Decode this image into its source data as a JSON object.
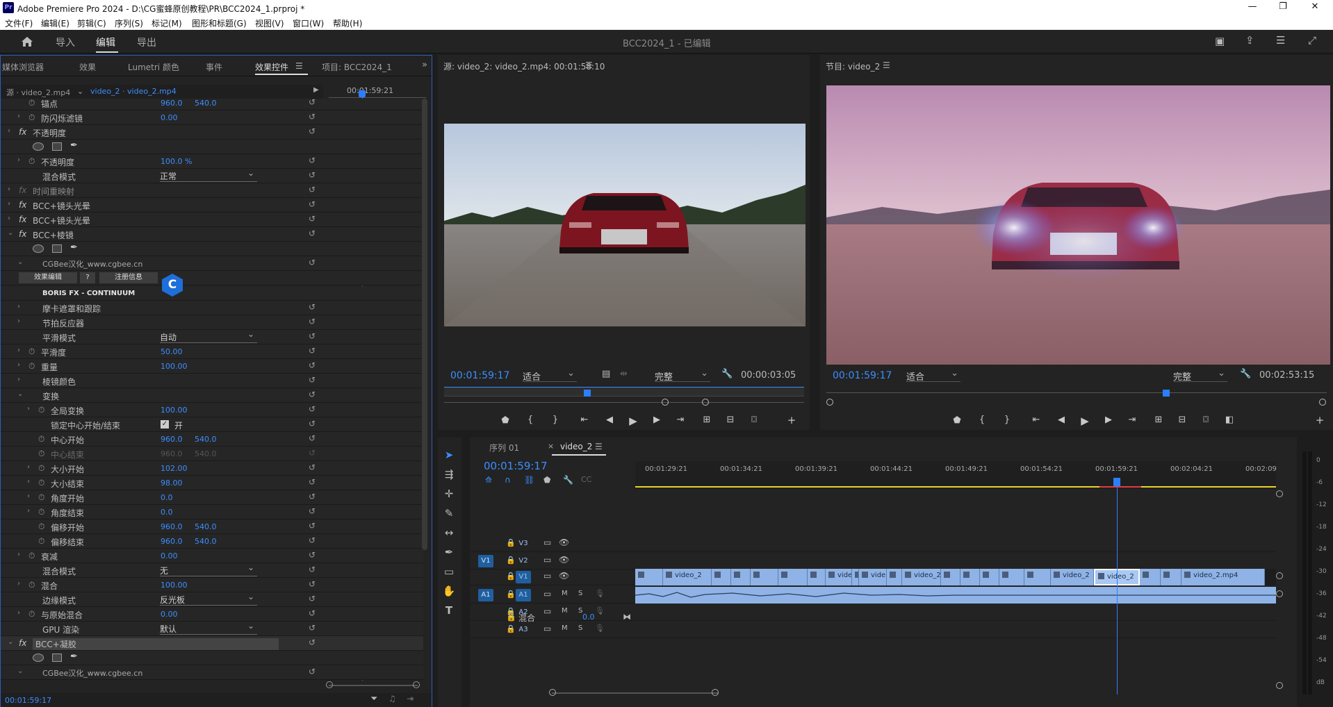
{
  "app": {
    "icon": "Pr",
    "title": "Adobe Premiere Pro 2024 - D:\\CG蜜蜂原创教程\\PR\\BCC2024_1.prproj *",
    "window_controls": [
      "—",
      "❐",
      "✕"
    ]
  },
  "menu": [
    "文件(F)",
    "编辑(E)",
    "剪辑(C)",
    "序列(S)",
    "标记(M)",
    "图形和标题(G)",
    "视图(V)",
    "窗口(W)",
    "帮助(H)"
  ],
  "workspace": {
    "tabs": [
      "导入",
      "编辑",
      "导出"
    ],
    "active": "编辑",
    "project_title": "BCC2024_1 - 已编辑"
  },
  "effects_panel": {
    "tabs": [
      "媒体浏览器",
      "效果",
      "Lumetri 颜色",
      "事件",
      "效果控件",
      "项目: BCC2024_1"
    ],
    "active_tab": "效果控件",
    "source_label": "源 · video_2.mp4",
    "clip_label": "video_2 · video_2.mp4",
    "mini_timecode": "00:01:59:21",
    "bottom_timecode": "00:01:59:17",
    "rows": [
      {
        "type": "prop",
        "indent": 2,
        "toggle": false,
        "stopwatch": true,
        "label": "锚点",
        "v1": "960.0",
        "v2": "540.0"
      },
      {
        "type": "prop",
        "indent": 2,
        "toggle": true,
        "stopwatch": true,
        "label": "防闪烁滤镜",
        "v1": "0.00"
      },
      {
        "type": "fx",
        "label": "不透明度"
      },
      {
        "type": "shapes"
      },
      {
        "type": "prop",
        "indent": 2,
        "toggle": true,
        "stopwatch": true,
        "label": "不透明度",
        "v1": "100.0 %"
      },
      {
        "type": "select",
        "indent": 2,
        "label": "混合模式",
        "value": "正常"
      },
      {
        "type": "fx",
        "label": "时间重映射",
        "dim": true
      },
      {
        "type": "fx",
        "label": "BCC+镜头光晕"
      },
      {
        "type": "fx",
        "label": "BCC+镜头光晕"
      },
      {
        "type": "fx",
        "label": "BCC+棱镜",
        "open": true
      },
      {
        "type": "shapes"
      },
      {
        "type": "text",
        "indent": 2,
        "toggle": true,
        "label": "CGBee汉化_www.cgbee.cn"
      },
      {
        "type": "buttons",
        "labels": [
          "效果编辑",
          "?",
          "注册信息"
        ]
      },
      {
        "type": "bold",
        "label": "BORIS FX - CONTINUUM"
      },
      {
        "type": "group",
        "indent": 2,
        "label": "摩卡遮罩和跟踪"
      },
      {
        "type": "group",
        "indent": 2,
        "label": "节拍反应器"
      },
      {
        "type": "select",
        "indent": 2,
        "label": "平滑模式",
        "value": "自动"
      },
      {
        "type": "prop",
        "indent": 2,
        "toggle": true,
        "stopwatch": true,
        "label": "平滑度",
        "v1": "50.00"
      },
      {
        "type": "prop",
        "indent": 2,
        "toggle": true,
        "stopwatch": true,
        "label": "重量",
        "v1": "100.00"
      },
      {
        "type": "group",
        "indent": 2,
        "label": "棱镜颜色"
      },
      {
        "type": "group",
        "indent": 2,
        "label": "变换",
        "open": true
      },
      {
        "type": "prop",
        "indent": 3,
        "toggle": true,
        "stopwatch": true,
        "label": "全局变换",
        "v1": "100.00"
      },
      {
        "type": "check",
        "indent": 3,
        "label": "锁定中心开始/结束",
        "value": "开"
      },
      {
        "type": "prop",
        "indent": 3,
        "stopwatch": true,
        "label": "中心开始",
        "v1": "960.0",
        "v2": "540.0"
      },
      {
        "type": "prop",
        "indent": 3,
        "stopwatch": true,
        "label": "中心结束",
        "v1": "960.0",
        "v2": "540.0",
        "dim": true
      },
      {
        "type": "prop",
        "indent": 3,
        "toggle": true,
        "stopwatch": true,
        "label": "大小开始",
        "v1": "102.00"
      },
      {
        "type": "prop",
        "indent": 3,
        "toggle": true,
        "stopwatch": true,
        "label": "大小结束",
        "v1": "98.00"
      },
      {
        "type": "prop",
        "indent": 3,
        "toggle": true,
        "stopwatch": true,
        "label": "角度开始",
        "v1": "0.0"
      },
      {
        "type": "prop",
        "indent": 3,
        "toggle": true,
        "stopwatch": true,
        "label": "角度结束",
        "v1": "0.0"
      },
      {
        "type": "prop",
        "indent": 3,
        "stopwatch": true,
        "label": "偏移开始",
        "v1": "960.0",
        "v2": "540.0"
      },
      {
        "type": "prop",
        "indent": 3,
        "stopwatch": true,
        "label": "偏移结束",
        "v1": "960.0",
        "v2": "540.0"
      },
      {
        "type": "prop",
        "indent": 2,
        "toggle": true,
        "stopwatch": true,
        "label": "衰减",
        "v1": "0.00"
      },
      {
        "type": "select",
        "indent": 2,
        "label": "混合模式",
        "value": "无"
      },
      {
        "type": "prop",
        "indent": 2,
        "toggle": true,
        "stopwatch": true,
        "label": "混合",
        "v1": "100.00"
      },
      {
        "type": "select",
        "indent": 2,
        "label": "边缘模式",
        "value": "反光板"
      },
      {
        "type": "prop",
        "indent": 2,
        "toggle": true,
        "stopwatch": true,
        "label": "与原始混合",
        "v1": "0.00"
      },
      {
        "type": "select",
        "indent": 2,
        "label": "GPU 渲染",
        "value": "默认"
      },
      {
        "type": "fx",
        "label": "BCC+凝胶",
        "open": true,
        "highlight": true
      },
      {
        "type": "shapes"
      },
      {
        "type": "text",
        "indent": 2,
        "toggle": true,
        "label": "CGBee汉化_www.cgbee.cn"
      }
    ]
  },
  "source_monitor": {
    "title": "源: video_2: video_2.mp4: 00:01:58:10",
    "timecode": "00:01:59:17",
    "fit": "适合",
    "quality": "完整",
    "duration": "00:00:03:05"
  },
  "program_monitor": {
    "title": "节目: video_2",
    "timecode": "00:01:59:17",
    "fit": "适合",
    "quality": "完整",
    "duration": "00:02:53:15"
  },
  "timeline": {
    "tabs": [
      "序列 01",
      "video_2"
    ],
    "active_tab": "video_2",
    "timecode": "00:01:59:17",
    "ruler": [
      "00:01:29:21",
      "00:01:34:21",
      "00:01:39:21",
      "00:01:44:21",
      "00:01:49:21",
      "00:01:54:21",
      "00:01:59:21",
      "00:02:04:21",
      "00:02:09"
    ],
    "tracks": [
      {
        "src": "",
        "name": "V3",
        "icons": [
          "🔒",
          "▭",
          "👁"
        ]
      },
      {
        "src": "V1",
        "name": "V2",
        "icons": [
          "🔒",
          "▭",
          "👁"
        ]
      },
      {
        "src": "",
        "name": "V1",
        "icons": [
          "🔒",
          "▭",
          "👁"
        ]
      },
      {
        "src": "A1",
        "name": "A1",
        "icons": [
          "🔒",
          "▭",
          "M",
          "S",
          "🎙"
        ]
      },
      {
        "src": "",
        "name": "A2",
        "icons": [
          "🔒",
          "▭",
          "M",
          "S",
          "🎙"
        ]
      },
      {
        "src": "",
        "name": "A3",
        "icons": [
          "🔒",
          "▭",
          "M",
          "S",
          "🎙"
        ]
      }
    ],
    "mix_label": "混合",
    "mix_value": "0.0",
    "clips": [
      {
        "w": 40,
        "label": ""
      },
      {
        "w": 70,
        "label": "video_2"
      },
      {
        "w": 28,
        "label": ""
      },
      {
        "w": 28,
        "label": ""
      },
      {
        "w": 40,
        "label": ""
      },
      {
        "w": 42,
        "label": ""
      },
      {
        "w": 26,
        "label": ""
      },
      {
        "w": 38,
        "label": "vide"
      },
      {
        "w": 10,
        "label": ""
      },
      {
        "w": 40,
        "label": "vide"
      },
      {
        "w": 22,
        "label": ""
      },
      {
        "w": 56,
        "label": "video_2"
      },
      {
        "w": 28,
        "label": ""
      },
      {
        "w": 28,
        "label": ""
      },
      {
        "w": 28,
        "label": ""
      },
      {
        "w": 36,
        "label": ""
      },
      {
        "w": 38,
        "label": ""
      },
      {
        "w": 62,
        "label": "video_2"
      },
      {
        "w": 66,
        "label": "video_2",
        "selected": true
      },
      {
        "w": 30,
        "label": ""
      },
      {
        "w": 30,
        "label": ""
      },
      {
        "w": 120,
        "label": "video_2.mp4"
      }
    ],
    "meter_ticks": [
      "0",
      "-6",
      "-12",
      "-18",
      "-24",
      "-30",
      "-36",
      "-42",
      "-48",
      "-54",
      "dB"
    ]
  }
}
